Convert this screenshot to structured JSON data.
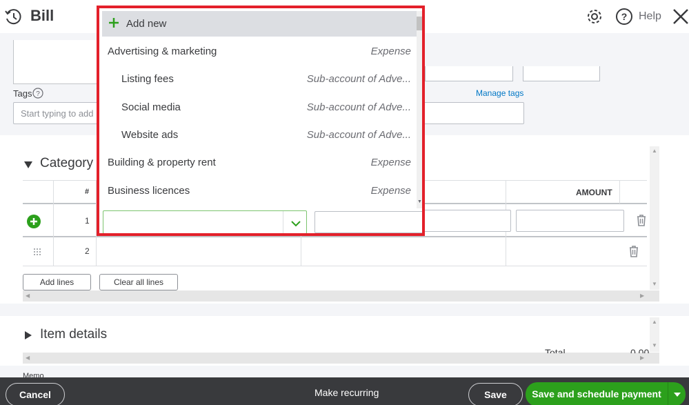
{
  "header": {
    "title": "Bill",
    "help_label": "Help"
  },
  "form": {
    "tags_label": "Tags",
    "tags_placeholder": "Start typing to add",
    "manage_tags": "Manage tags"
  },
  "category": {
    "title": "Category",
    "col_num": "#",
    "col_amount": "AMOUNT",
    "rows": [
      "1",
      "2"
    ],
    "add_lines": "Add lines",
    "clear_all_lines": "Clear all lines"
  },
  "item_details": {
    "title": "Item details",
    "total_label": "Total",
    "total_value": "0.00",
    "memo_label": "Memo"
  },
  "footer": {
    "cancel": "Cancel",
    "make_recurring": "Make recurring",
    "save": "Save",
    "save_and_schedule": "Save and schedule payment"
  },
  "dropdown": {
    "add_new": "Add new",
    "items": [
      {
        "name": "Advertising & marketing",
        "type": "Expense",
        "sub": false
      },
      {
        "name": "Listing fees",
        "type": "Sub-account of Adve...",
        "sub": true
      },
      {
        "name": "Social media",
        "type": "Sub-account of Adve...",
        "sub": true
      },
      {
        "name": "Website ads",
        "type": "Sub-account of Adve...",
        "sub": true
      },
      {
        "name": "Building & property rent",
        "type": "Expense",
        "sub": false
      },
      {
        "name": "Business licences",
        "type": "Expense",
        "sub": false
      }
    ]
  },
  "colors": {
    "accent_green": "#2ca01c",
    "highlight_red": "#e3202a",
    "footer_bg": "#393a3d",
    "link_blue": "#0077c5"
  }
}
